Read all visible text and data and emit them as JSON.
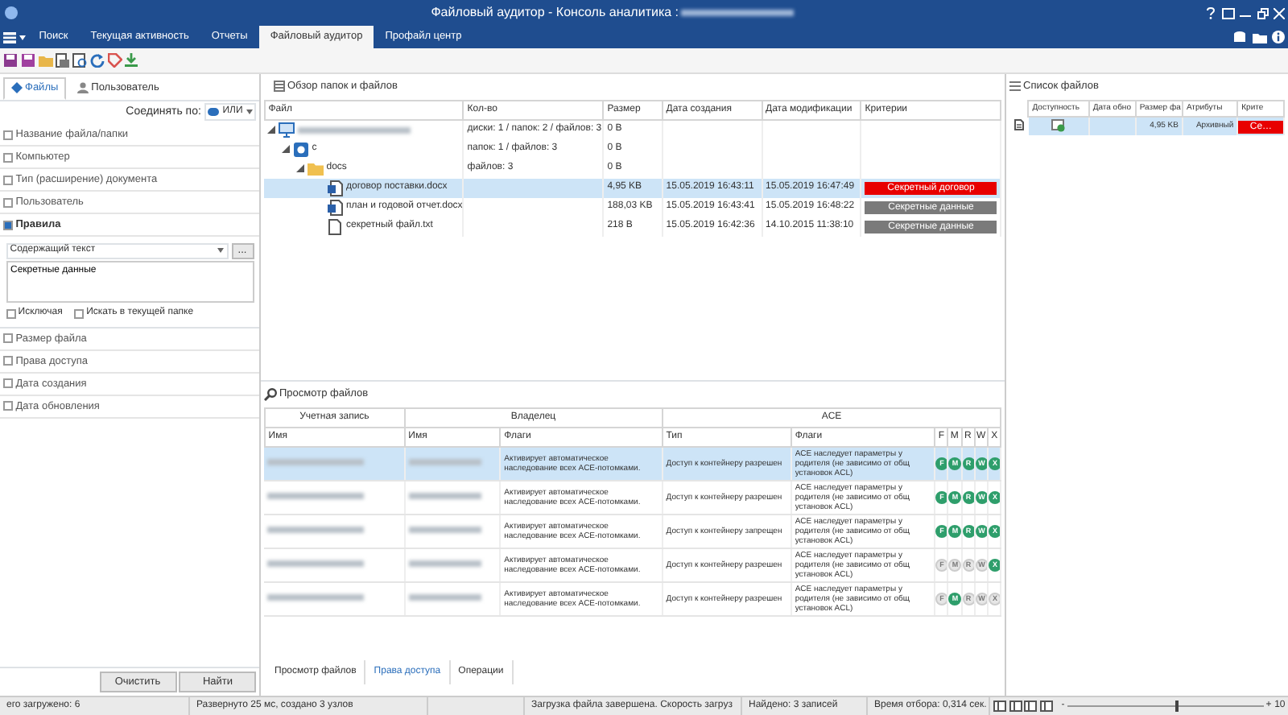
{
  "window": {
    "title": "Файловый аудитор - Консоль аналитика :"
  },
  "ribbon_tabs": [
    {
      "label": "Поиск",
      "selected": false
    },
    {
      "label": "Текущая активность",
      "selected": false
    },
    {
      "label": "Отчеты",
      "selected": false
    },
    {
      "label": "Файловый аудитор",
      "selected": true
    },
    {
      "label": "Профайл центр",
      "selected": false
    }
  ],
  "left_panel": {
    "tabs": [
      {
        "label": "Файлы",
        "selected": true
      },
      {
        "label": "Пользователь",
        "selected": false
      }
    ],
    "join_label": "Соединять по:",
    "join_value": "ИЛИ",
    "filters": [
      {
        "label": "Название файла/папки",
        "expanded": false
      },
      {
        "label": "Компьютер",
        "expanded": false
      },
      {
        "label": "Тип (расширение) документа",
        "expanded": false
      },
      {
        "label": "Пользователь",
        "expanded": false
      },
      {
        "label": "Правила",
        "expanded": true,
        "rule": {
          "type": "Содержащий текст",
          "more": "...",
          "text": "Секретные данные",
          "options": [
            {
              "label": "Исключая",
              "checked": false
            },
            {
              "label": "Искать в текущей папке",
              "checked": false
            }
          ]
        }
      },
      {
        "label": "Размер файла",
        "expanded": false
      },
      {
        "label": "Права доступа",
        "expanded": false
      },
      {
        "label": "Дата создания",
        "expanded": false
      },
      {
        "label": "Дата обновления",
        "expanded": false
      }
    ],
    "buttons": [
      "Очистить",
      "Найти"
    ]
  },
  "tree": {
    "title": "Обзор папок и файлов",
    "columns": [
      "Файл",
      "Кол-во",
      "Размер",
      "Дата создания",
      "Дата модификации",
      "Критерии"
    ],
    "rows": [
      {
        "kind": "computer",
        "expanded": true,
        "count": "диски: 1 / папок: 2 / файлов: 3",
        "size": "0 B",
        "selected": false,
        "children": [
          {
            "kind": "disk",
            "name": "c",
            "expanded": true,
            "count": "папок: 1 / файлов: 3",
            "size": "0 B",
            "selected": false,
            "children": [
              {
                "kind": "folder",
                "name": "docs",
                "expanded": true,
                "count": "файлов: 3",
                "size": "0 B",
                "selected": false,
                "children": [
                  {
                    "kind": "docx",
                    "name": "договор поставки.docx",
                    "size": "4,95 KB",
                    "created": "15.05.2019 16:43:11",
                    "modified": "15.05.2019 16:47:49",
                    "criterion": "Секретный договор",
                    "color": "#e80000",
                    "selected": true
                  },
                  {
                    "kind": "docx",
                    "name": "план и годовой отчет.docx",
                    "size": "188,03 KB",
                    "created": "15.05.2019 16:43:41",
                    "modified": "15.05.2019 16:48:22",
                    "criterion": "Секретные данные",
                    "color": "#7a7a7a",
                    "selected": false
                  },
                  {
                    "kind": "txt",
                    "name": "секретный файл.txt",
                    "size": "218 B",
                    "created": "15.05.2019 16:42:36",
                    "modified": "14.10.2015 11:38:10",
                    "criterion": "Секретные данные",
                    "color": "#7a7a7a",
                    "selected": false
                  }
                ]
              }
            ]
          }
        ]
      }
    ]
  },
  "file_list": {
    "title": "Список файлов",
    "columns": [
      "Доступность",
      "Дата обно",
      "Размер фа",
      "Атрибуты",
      "Крите"
    ],
    "rows": [
      {
        "size": "4,95 KB",
        "attributes": "Архивный",
        "criterion": "Се…",
        "color": "#e80000",
        "selected": true
      }
    ]
  },
  "file_view": {
    "title": "Просмотр файлов",
    "groups": [
      "Учетная запись",
      "Владелец",
      "ACE"
    ],
    "columns": [
      "Имя",
      "Имя",
      "Флаги",
      "Тип",
      "Флаги",
      "F",
      "M",
      "R",
      "W",
      "X"
    ],
    "rows": [
      {
        "owner_flags": "Активирует автоматическое наследование всех ACE-потомками.",
        "type": "Доступ к контейнеру разрешен",
        "ace_flags": "ACE наследует параметры у родителя (не зависимо от общ установок ACL)",
        "selected": true,
        "perms": [
          {
            "letter": "F",
            "on": true
          },
          {
            "letter": "M",
            "on": true
          },
          {
            "letter": "R",
            "on": true
          },
          {
            "letter": "W",
            "on": true
          },
          {
            "letter": "X",
            "on": true
          }
        ]
      },
      {
        "owner_flags": "Активирует автоматическое наследование всех ACE-потомками.",
        "type": "Доступ к контейнеру разрешен",
        "ace_flags": "ACE наследует параметры у родителя (не зависимо от общ установок ACL)",
        "selected": false,
        "perms": [
          {
            "letter": "F",
            "on": true
          },
          {
            "letter": "M",
            "on": true
          },
          {
            "letter": "R",
            "on": true
          },
          {
            "letter": "W",
            "on": true
          },
          {
            "letter": "X",
            "on": true
          }
        ]
      },
      {
        "owner_flags": "Активирует автоматическое наследование всех ACE-потомками.",
        "type": "Доступ к контейнеру запрещен",
        "ace_flags": "ACE наследует параметры у родителя (не зависимо от общ установок ACL)",
        "selected": false,
        "perms": [
          {
            "letter": "F",
            "on": true
          },
          {
            "letter": "M",
            "on": true
          },
          {
            "letter": "R",
            "on": true
          },
          {
            "letter": "W",
            "on": true
          },
          {
            "letter": "X",
            "on": true
          }
        ]
      },
      {
        "owner_flags": "Активирует автоматическое наследование всех ACE-потомками.",
        "type": "Доступ к контейнеру разрешен",
        "ace_flags": "ACE наследует параметры у родителя (не зависимо от общ установок ACL)",
        "selected": false,
        "perms": [
          {
            "letter": "F",
            "on": false
          },
          {
            "letter": "M",
            "on": false
          },
          {
            "letter": "R",
            "on": false
          },
          {
            "letter": "W",
            "on": false
          },
          {
            "letter": "X",
            "on": true
          }
        ]
      },
      {
        "owner_flags": "Активирует автоматическое наследование всех ACE-потомками.",
        "type": "Доступ к контейнеру разрешен",
        "ace_flags": "ACE наследует параметры у родителя (не зависимо от общ установок ACL)",
        "selected": false,
        "perms": [
          {
            "letter": "F",
            "on": false
          },
          {
            "letter": "M",
            "on": true
          },
          {
            "letter": "R",
            "on": false
          },
          {
            "letter": "W",
            "on": false
          },
          {
            "letter": "X",
            "on": false
          }
        ]
      }
    ],
    "tabs": [
      {
        "label": "Просмотр файлов",
        "selected": false
      },
      {
        "label": "Права доступа",
        "selected": true
      },
      {
        "label": "Операции",
        "selected": false
      }
    ]
  },
  "status_bar": {
    "cells": [
      "его загружено: 6",
      "Развернуто 25 мс, создано 3 узлов",
      "Загрузка файла завершена. Скорость загруз",
      "Найдено: 3 записей",
      "Время отбора: 0,314 сек."
    ],
    "zoom_minus": "-",
    "zoom_plus": "+",
    "zoom_slider": {
      "level": 0.55
    },
    "zoom_value": "10"
  }
}
